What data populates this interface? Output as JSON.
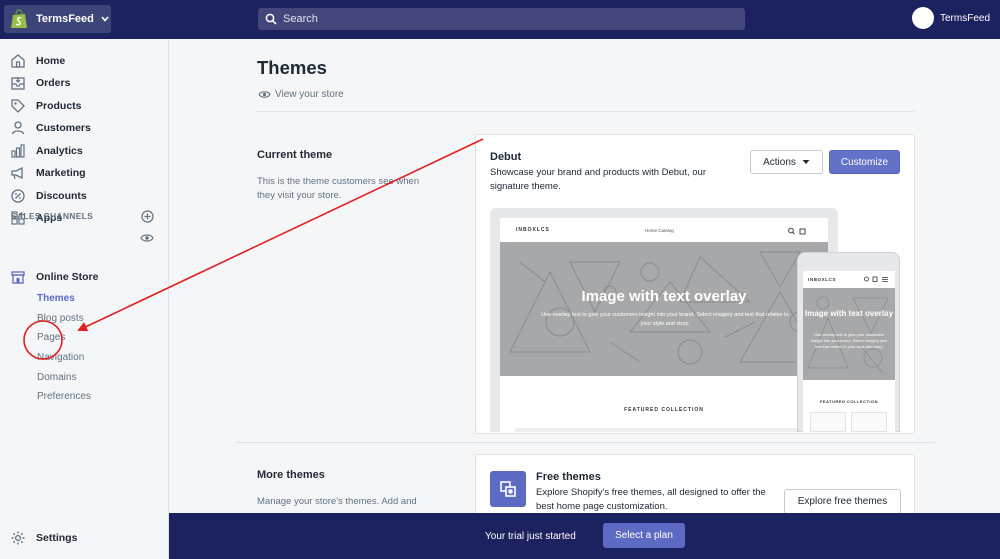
{
  "topbar": {
    "store_name": "TermsFeed",
    "search_placeholder": "Search",
    "user_name": "TermsFeed"
  },
  "sidebar": {
    "items": [
      {
        "label": "Home",
        "icon": "home-icon"
      },
      {
        "label": "Orders",
        "icon": "orders-icon"
      },
      {
        "label": "Products",
        "icon": "tag-icon"
      },
      {
        "label": "Customers",
        "icon": "person-icon"
      },
      {
        "label": "Analytics",
        "icon": "bar-chart-icon"
      },
      {
        "label": "Marketing",
        "icon": "megaphone-icon"
      },
      {
        "label": "Discounts",
        "icon": "discount-icon"
      },
      {
        "label": "Apps",
        "icon": "apps-icon"
      }
    ],
    "sales_channels_heading": "SALES CHANNELS",
    "online_store": "Online Store",
    "sub_items": [
      "Themes",
      "Blog posts",
      "Pages",
      "Navigation",
      "Domains",
      "Preferences"
    ],
    "active_sub_item": "Themes",
    "settings": "Settings"
  },
  "main": {
    "title": "Themes",
    "view_store": "View your store",
    "current_theme": {
      "heading": "Current theme",
      "description": "This is the theme customers see when they visit your store.",
      "theme_name": "Debut",
      "theme_description": "Showcase your brand and products with Debut, our signature theme.",
      "actions_label": "Actions",
      "customize_label": "Customize"
    },
    "preview": {
      "logo": "INBOXLCS",
      "nav_links": "Home    Catalog",
      "hero_title": "Image with text overlay",
      "hero_subtitle": "Use overlay text to give your customers insight into your brand. Select imagery and text that relates to your style and story.",
      "featured": "FEATURED COLLECTION",
      "mobile_hero_title": "Image with text overlay",
      "mobile_hero_subtitle": "Use overlay text to give your customers insight into your brand. Select imagery and text that relates to your style and story.",
      "mobile_featured": "FEATURED COLLECTION"
    },
    "more_themes": {
      "heading": "More themes",
      "description": "Manage your store's themes. Add and",
      "free_title": "Free themes",
      "free_description": "Explore Shopify's free themes, all designed to offer the best home page customization.",
      "explore_label": "Explore free themes"
    }
  },
  "trial": {
    "text": "Your trial just started",
    "button": "Select a plan"
  },
  "colors": {
    "topbar": "#1c2260",
    "accent": "#5c6ac4",
    "annotation": "#e02020"
  }
}
